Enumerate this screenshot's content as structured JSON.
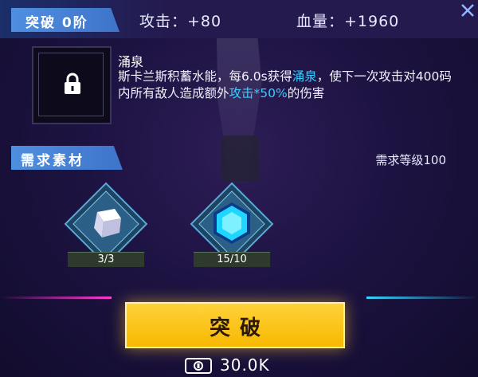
{
  "header": {
    "rank_label": "突破 0阶",
    "attack": "攻击：+80",
    "hp": "血量：+1960"
  },
  "skill": {
    "name": "涌泉",
    "desc_part1": "斯卡兰斯积蓄水能，每6.0s获得",
    "desc_hl1": "涌泉",
    "desc_part2": "，使下一次攻击对400码内所有敌人造成额外",
    "desc_hl2": "攻击*50%",
    "desc_part3": "的伤害"
  },
  "materials": {
    "section_title": "需求素材",
    "required_level": "需求等级100",
    "items": [
      {
        "icon": "white-crystal-cube-icon",
        "count": "3/3"
      },
      {
        "icon": "blue-hexagon-gem-icon",
        "count": "15/10"
      }
    ]
  },
  "action": {
    "button_label": "突破",
    "cost": "30.0K",
    "cost_icon": "currency-note-icon"
  },
  "colors": {
    "accent_blue": "#4f8fe0",
    "highlight_cyan": "#34cfff",
    "button_yellow": "#f7b800",
    "background": "#1d1342"
  }
}
